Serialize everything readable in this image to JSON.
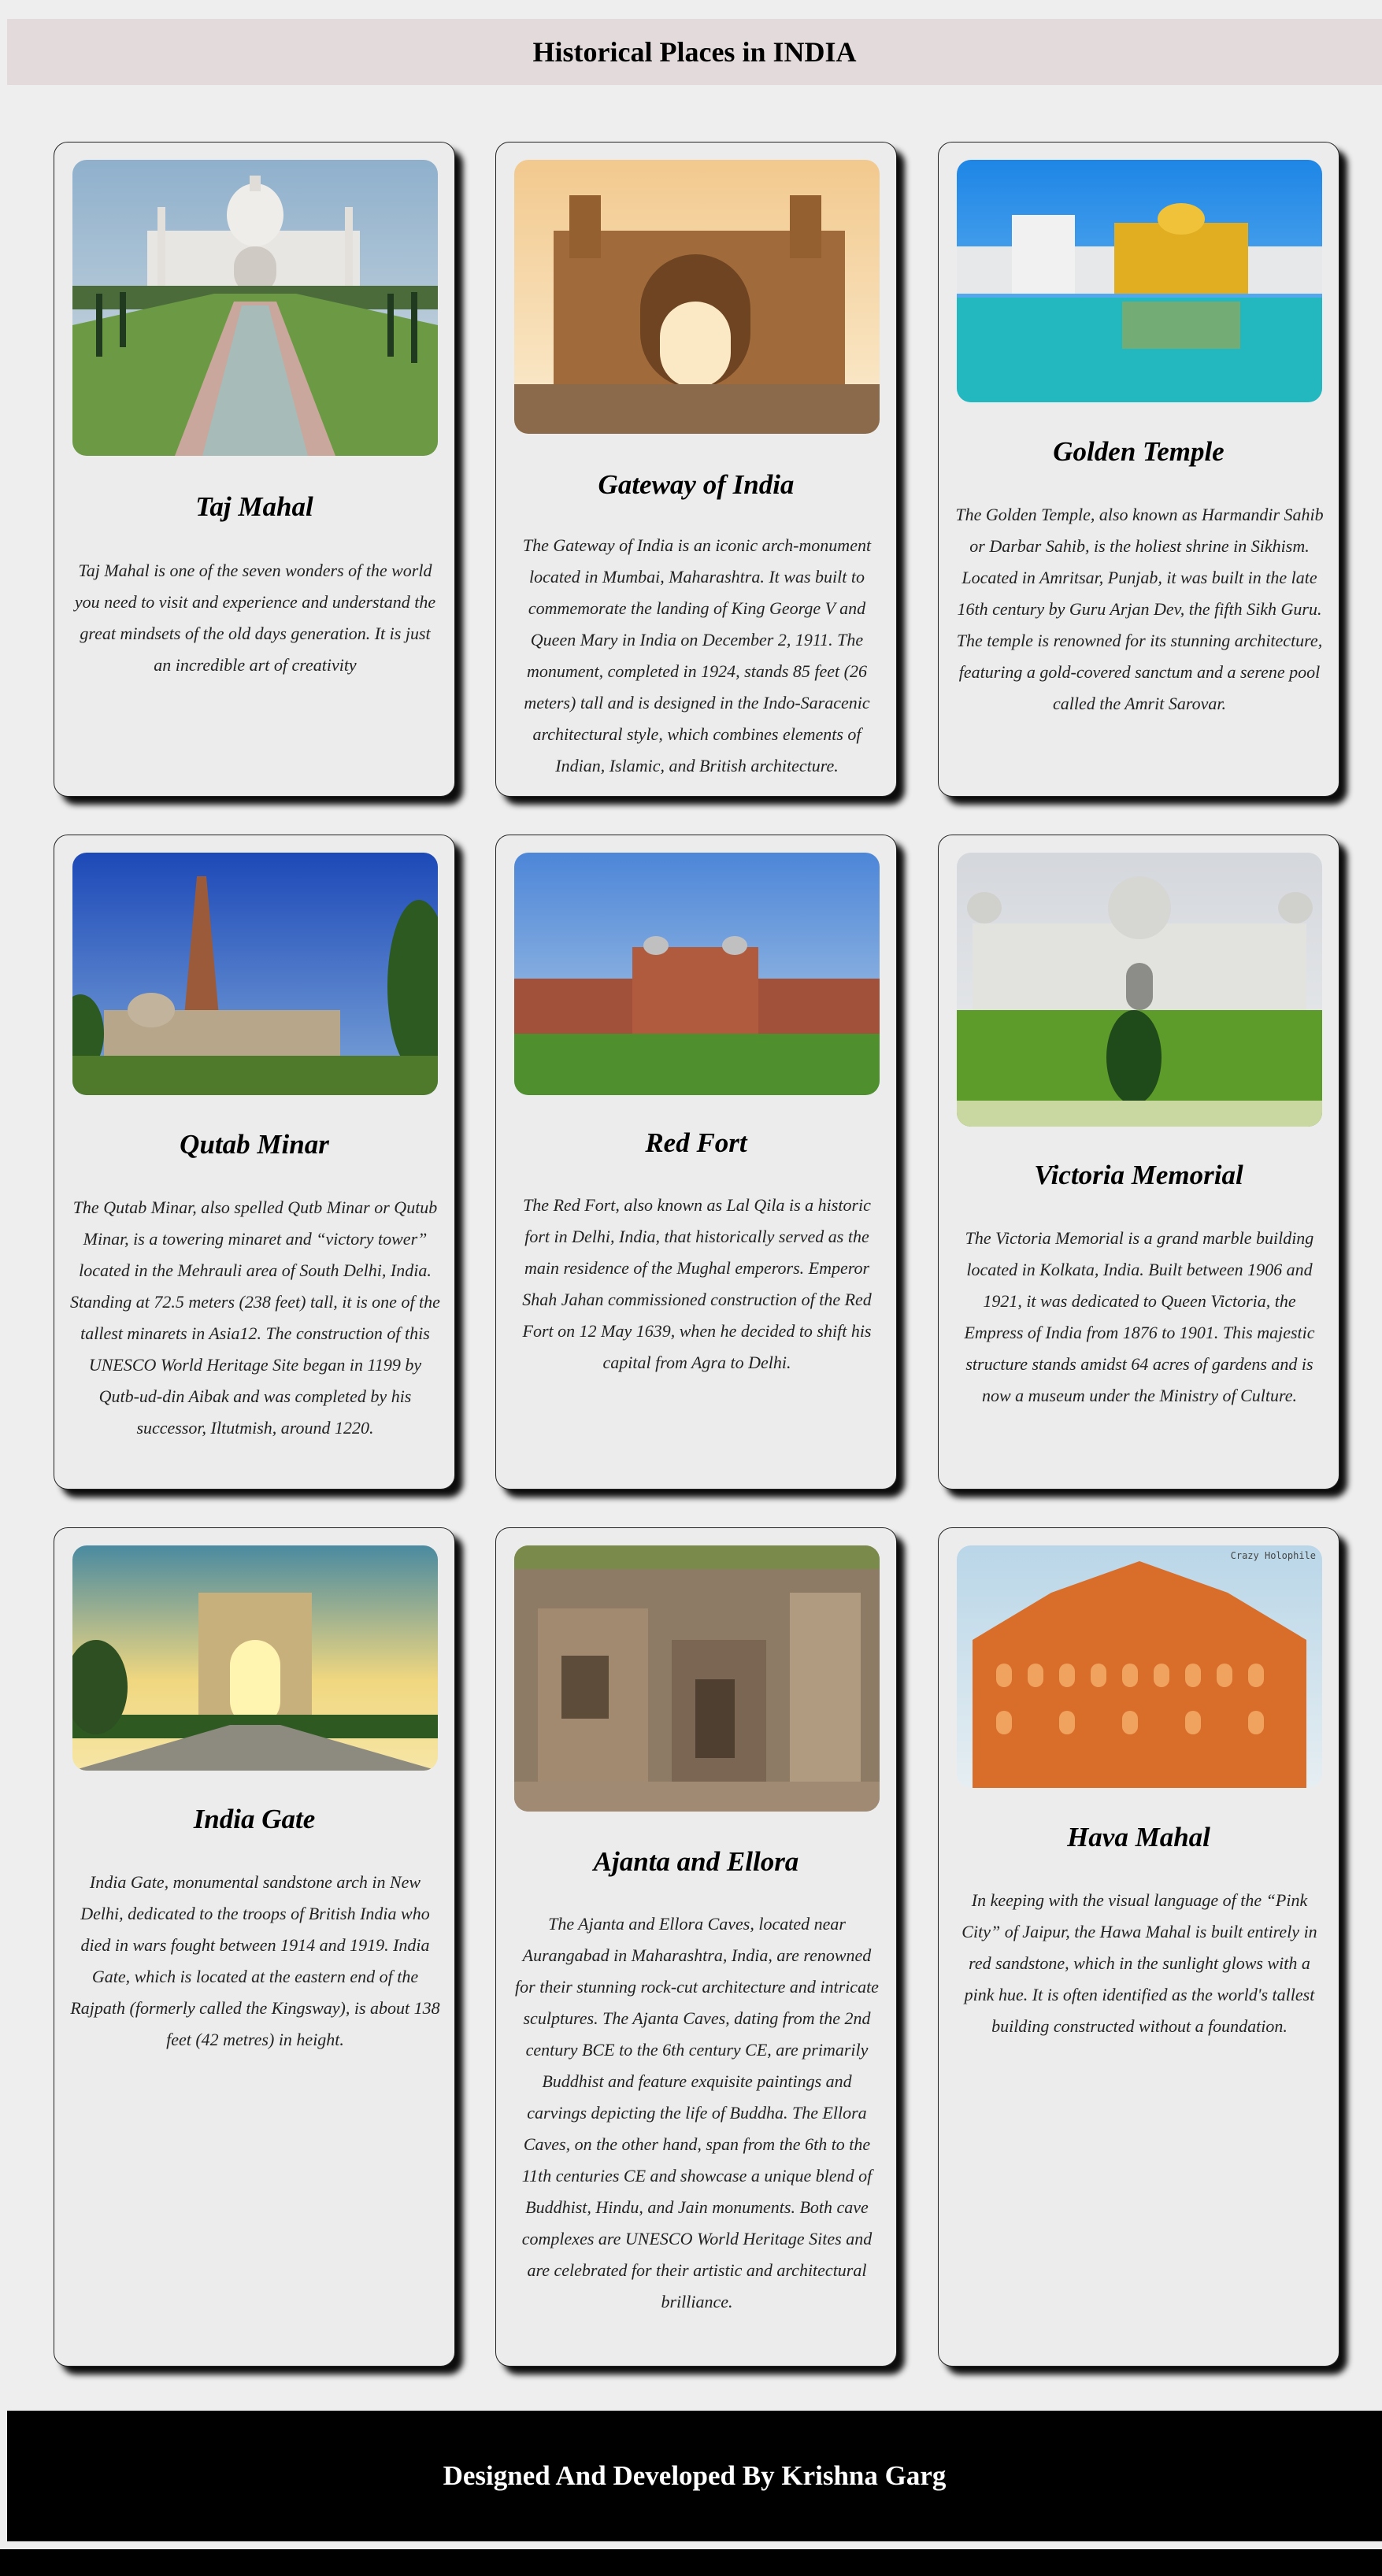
{
  "header": {
    "title": "Historical Places in INDIA"
  },
  "cards": [
    {
      "title": "Taj Mahal",
      "image_icon": "taj-mahal-image",
      "description": "Taj Mahal is one of the seven wonders of the world you need to visit and experience and understand the great mindsets of the old days generation. It is just an incredible art of creativity"
    },
    {
      "title": "Gateway of India",
      "image_icon": "gateway-of-india-image",
      "description": "The Gateway of India is an iconic arch-monument located in Mumbai, Maharashtra. It was built to commemorate the landing of King George V and Queen Mary in India on December 2, 1911. The monument, completed in 1924, stands 85 feet (26 meters) tall and is designed in the Indo-Saracenic architectural style, which combines elements of Indian, Islamic, and British architecture."
    },
    {
      "title": "Golden Temple",
      "image_icon": "golden-temple-image",
      "description": "The Golden Temple, also known as Harmandir Sahib or Darbar Sahib, is the holiest shrine in Sikhism. Located in Amritsar, Punjab, it was built in the late 16th century by Guru Arjan Dev, the fifth Sikh Guru. The temple is renowned for its stunning architecture, featuring a gold-covered sanctum and a serene pool called the Amrit Sarovar."
    },
    {
      "title": "Qutab Minar",
      "image_icon": "qutab-minar-image",
      "description": "The Qutab Minar, also spelled Qutb Minar or Qutub Minar, is a towering minaret and “victory tower” located in the Mehrauli area of South Delhi, India. Standing at 72.5 meters (238 feet) tall, it is one of the tallest minarets in Asia12. The construction of this UNESCO World Heritage Site began in 1199 by Qutb-ud-din Aibak and was completed by his successor, Iltutmish, around 1220."
    },
    {
      "title": "Red Fort",
      "image_icon": "red-fort-image",
      "description": "The Red Fort, also known as Lal Qila is a historic fort in Delhi, India, that historically served as the main residence of the Mughal emperors. Emperor Shah Jahan commissioned construction of the Red Fort on 12 May 1639, when he decided to shift his capital from Agra to Delhi."
    },
    {
      "title": "Victoria Memorial",
      "image_icon": "victoria-memorial-image",
      "description": "The Victoria Memorial is a grand marble building located in Kolkata, India. Built between 1906 and 1921, it was dedicated to Queen Victoria, the Empress of India from 1876 to 1901. This majestic structure stands amidst 64 acres of gardens and is now a museum under the Ministry of Culture."
    },
    {
      "title": "India Gate",
      "image_icon": "india-gate-image",
      "description": "India Gate, monumental sandstone arch in New Delhi, dedicated to the troops of British India who died in wars fought between 1914 and 1919. India Gate, which is located at the eastern end of the Rajpath (formerly called the Kingsway), is about 138 feet (42 metres) in height."
    },
    {
      "title": "Ajanta and Ellora",
      "image_icon": "ajanta-ellora-image",
      "description": "The Ajanta and Ellora Caves, located near Aurangabad in Maharashtra, India, are renowned for their stunning rock-cut architecture and intricate sculptures. The Ajanta Caves, dating from the 2nd century BCE to the 6th century CE, are primarily Buddhist and feature exquisite paintings and carvings depicting the life of Buddha. The Ellora Caves, on the other hand, span from the 6th to the 11th centuries CE and showcase a unique blend of Buddhist, Hindu, and Jain monuments. Both cave complexes are UNESCO World Heritage Sites and are celebrated for their artistic and architectural brilliance."
    },
    {
      "title": "Hava Mahal",
      "image_icon": "hawa-mahal-image",
      "image_watermark": "Crazy Holophile",
      "description": "In keeping with the visual language of the “Pink City” of Jaipur, the Hawa Mahal is built entirely in red sandstone, which in the sunlight glows with a pink hue. It is often identified as the world's tallest building constructed without a foundation."
    }
  ],
  "footer": {
    "credit": "Designed And Developed By Krishna Garg"
  }
}
